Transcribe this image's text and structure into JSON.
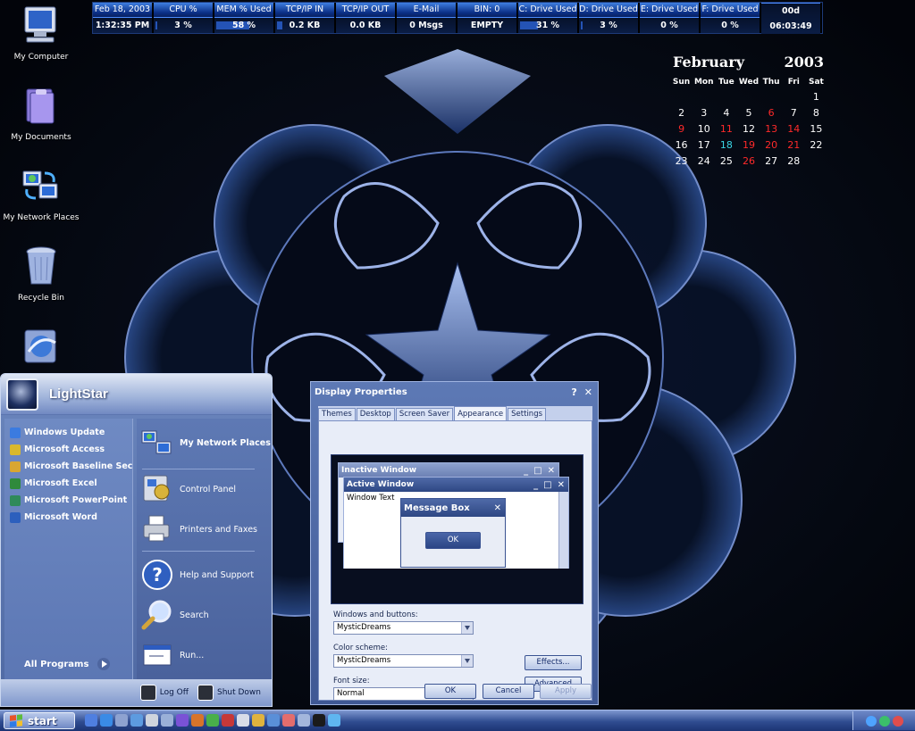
{
  "desktop": {
    "icons": [
      {
        "label": "My Computer",
        "icon": "my-computer-icon"
      },
      {
        "label": "My Documents",
        "icon": "my-documents-icon"
      },
      {
        "label": "My Network Places",
        "icon": "network-places-icon"
      },
      {
        "label": "Recycle Bin",
        "icon": "recycle-bin-icon"
      },
      {
        "label": "",
        "icon": "internet-explorer-icon"
      }
    ]
  },
  "statusbar": [
    {
      "header": "Feb 18, 2003",
      "value": "1:32:35 PM",
      "level": null
    },
    {
      "header": "CPU %",
      "value": "3 %",
      "level": 0.03
    },
    {
      "header": "MEM % Used",
      "value": "58 %",
      "level": 0.58
    },
    {
      "header": "TCP/IP IN",
      "value": "0.2 KB",
      "level": 0.1
    },
    {
      "header": "TCP/IP OUT",
      "value": "0.0 KB",
      "level": 0
    },
    {
      "header": "E-Mail",
      "value": "0 Msgs",
      "level": null
    },
    {
      "header": "BIN: 0",
      "value": "EMPTY",
      "level": null
    },
    {
      "header": "C: Drive Used",
      "value": "31 %",
      "level": 0.31
    },
    {
      "header": "D: Drive Used",
      "value": "3 %",
      "level": 0.03
    },
    {
      "header": "E: Drive Used",
      "value": "0 %",
      "level": 0
    },
    {
      "header": "F: Drive Used",
      "value": "0 %",
      "level": 0
    },
    {
      "header": "Uptime",
      "value": "00d 06:03:49",
      "level": null
    }
  ],
  "calendar": {
    "month": "February",
    "year": "2003",
    "weekdays": [
      "Sun",
      "Mon",
      "Tue",
      "Wed",
      "Thu",
      "Fri",
      "Sat"
    ],
    "weeks": [
      [
        "",
        "",
        "",
        "",
        "",
        "",
        "1"
      ],
      [
        "2",
        "3",
        "4",
        "5",
        "6",
        "7",
        "8"
      ],
      [
        "9",
        "10",
        "11",
        "12",
        "13",
        "14",
        "15"
      ],
      [
        "16",
        "17",
        "18",
        "19",
        "20",
        "21",
        "22"
      ],
      [
        "23",
        "24",
        "25",
        "26",
        "27",
        "28",
        ""
      ]
    ],
    "red_days": [
      "6",
      "9",
      "11",
      "13",
      "14",
      "19",
      "20",
      "21",
      "26"
    ],
    "today": "18",
    "colors": {
      "red": "#ff2a2a",
      "today": "#3ad6e6"
    }
  },
  "start_menu": {
    "user": "LightStar",
    "pinned": [
      {
        "label": "Windows Update",
        "icon": "windows-update-icon",
        "color": "#3b7be0"
      },
      {
        "label": "Microsoft Access",
        "icon": "access-key-icon",
        "color": "#d9b82c"
      },
      {
        "label": "Microsoft Baseline Securi...",
        "icon": "baseline-security-icon",
        "color": "#d8a632"
      },
      {
        "label": "Microsoft Excel",
        "icon": "excel-icon",
        "color": "#2f8a3c"
      },
      {
        "label": "Microsoft PowerPoint",
        "icon": "powerpoint-icon",
        "color": "#2f8a5a"
      },
      {
        "label": "Microsoft Word",
        "icon": "word-icon",
        "color": "#2c5fbd"
      }
    ],
    "all_programs": "All Programs",
    "places": [
      {
        "label": "My Network Places",
        "icon": "network-places-icon"
      },
      {
        "label": "Control Panel",
        "icon": "control-panel-icon"
      },
      {
        "label": "Printers and Faxes",
        "icon": "printer-icon"
      },
      {
        "label": "Help and Support",
        "icon": "help-icon"
      },
      {
        "label": "Search",
        "icon": "search-icon"
      },
      {
        "label": "Run...",
        "icon": "run-icon"
      }
    ],
    "log_off": "Log Off",
    "shut_down": "Shut Down"
  },
  "display_properties": {
    "title": "Display Properties",
    "title_buttons": [
      "?",
      "✕"
    ],
    "tabs": [
      "Themes",
      "Desktop",
      "Screen Saver",
      "Appearance",
      "Settings"
    ],
    "active_tab": "Appearance",
    "preview": {
      "inactive_window": "Inactive Window",
      "active_window": "Active Window",
      "window_text": "Window Text",
      "message_box": "Message Box",
      "ok": "OK"
    },
    "windows_buttons_label": "Windows and buttons:",
    "windows_buttons_value": "MysticDreams",
    "color_scheme_label": "Color scheme:",
    "color_scheme_value": "MysticDreams",
    "font_size_label": "Font size:",
    "font_size_value": "Normal",
    "effects": "Effects...",
    "advanced": "Advanced",
    "ok": "OK",
    "cancel": "Cancel",
    "apply": "Apply"
  },
  "taskbar": {
    "start": "start",
    "quicklaunch": [
      {
        "icon": "show-desktop-icon",
        "color": "#4f7fe0"
      },
      {
        "icon": "internet-explorer-icon",
        "color": "#3a8be6"
      },
      {
        "icon": "media-player-icon",
        "color": "#8ea2d0"
      },
      {
        "icon": "globe-icon",
        "color": "#5d9be0"
      },
      {
        "icon": "printer-icon",
        "color": "#cfd4dd"
      },
      {
        "icon": "computer-icon",
        "color": "#9ab0d8"
      },
      {
        "icon": "paint-icon",
        "color": "#7a52d6"
      },
      {
        "icon": "firefox-icon",
        "color": "#d8742a"
      },
      {
        "icon": "green-orb-icon",
        "color": "#49b04a"
      },
      {
        "icon": "red-orb-icon",
        "color": "#c63838"
      },
      {
        "icon": "r-letter-icon",
        "color": "#d8dde8"
      },
      {
        "icon": "home-icon",
        "color": "#e0b33e"
      },
      {
        "icon": "mail-icon",
        "color": "#5a8fd8"
      },
      {
        "icon": "pencil-icon",
        "color": "#e36d6d"
      },
      {
        "icon": "settings-icon",
        "color": "#a3b6dc"
      },
      {
        "icon": "command-prompt-icon",
        "color": "#1b1b1b"
      },
      {
        "icon": "diamond-icon",
        "color": "#5fb6f0"
      }
    ],
    "tray": [
      {
        "icon": "network-tray-icon",
        "color": "#4fa3ff"
      },
      {
        "icon": "volume-tray-icon",
        "color": "#3bbf6a"
      },
      {
        "icon": "security-tray-icon",
        "color": "#e04d4d"
      }
    ]
  }
}
